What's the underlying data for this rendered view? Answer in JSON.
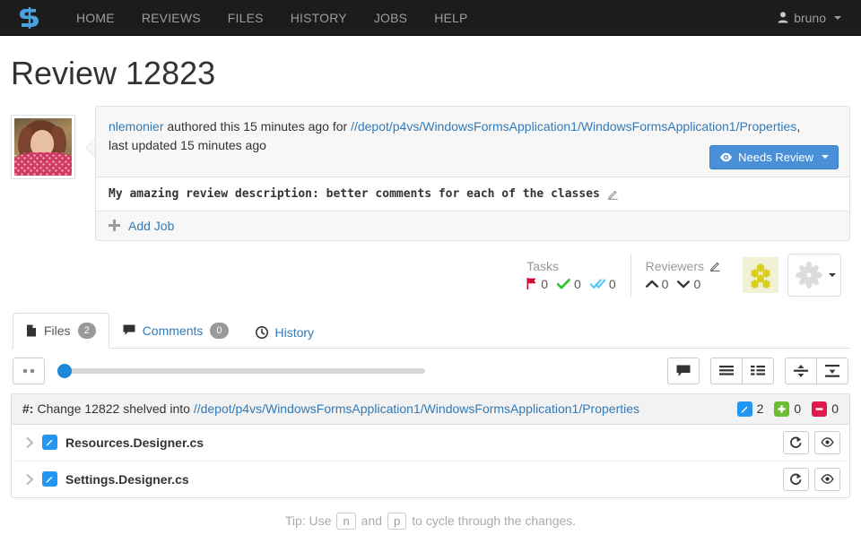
{
  "navbar": {
    "brand_icon": "swarm-s-logo-icon",
    "links": [
      {
        "label": "HOME",
        "name": "nav-link-home"
      },
      {
        "label": "REVIEWS",
        "name": "nav-link-reviews"
      },
      {
        "label": "FILES",
        "name": "nav-link-files"
      },
      {
        "label": "HISTORY",
        "name": "nav-link-history"
      },
      {
        "label": "JOBS",
        "name": "nav-link-jobs"
      },
      {
        "label": "HELP",
        "name": "nav-link-help"
      }
    ],
    "user": "bruno",
    "user_icon": "user-icon",
    "brand_color": "#4aa3df",
    "background": "#1c1c1c"
  },
  "page": {
    "title": "Review 12823"
  },
  "review": {
    "author": "nlemonier",
    "authored_text": "authored this 15 minutes ago for",
    "path": "//depot/p4vs/WindowsFormsApplication1/WindowsFormsApplication1/Properties",
    "path_suffix": ",",
    "updated_text": "last updated 15 minutes ago",
    "state_button": {
      "label": "Needs Review",
      "icon": "eye-icon",
      "color": "#4a90d9"
    },
    "description": "My amazing review description: better comments for each of the classes",
    "edit_icon": "pencil-icon",
    "add_job_label": "Add Job",
    "add_job_icon": "plus-icon"
  },
  "meta": {
    "tasks": {
      "label": "Tasks",
      "open": "0",
      "open_icon": "flag-icon",
      "addressed": "0",
      "addressed_icon": "check-icon",
      "verified": "0",
      "verified_icon": "double-check-icon"
    },
    "reviewers": {
      "label": "Reviewers",
      "edit_icon": "pencil-icon",
      "up": "0",
      "up_icon": "chevron-up-icon",
      "down": "0",
      "down_icon": "chevron-down-icon"
    },
    "avatars": {
      "hex_avatar": "hexagon-cluster-avatar",
      "flower_avatar": "flower-avatar",
      "dropdown_icon": "caret-down-icon"
    }
  },
  "tabs": [
    {
      "label": "Files",
      "badge": "2",
      "icon": "file-icon",
      "active": true,
      "name": "tab-files"
    },
    {
      "label": "Comments",
      "badge": "0",
      "icon": "comment-icon",
      "active": false,
      "name": "tab-comments"
    },
    {
      "label": "History",
      "badge": "",
      "icon": "clock-icon",
      "active": false,
      "name": "tab-history"
    }
  ],
  "toolbar": {
    "diff_toggle_icon": "ellipsis-icon",
    "slider_value": 0,
    "comment_icon": "comment-icon",
    "view_list_icon": "list-view-icon",
    "view_detail_icon": "detail-view-icon",
    "collapse_icon": "collapse-icon",
    "expand_icon": "expand-icon"
  },
  "change": {
    "lead": "#:",
    "text": "Change 12822 shelved into",
    "path": "//depot/p4vs/WindowsFormsApplication1/WindowsFormsApplication1/Properties",
    "stats": [
      {
        "icon": "edit-badge-icon",
        "color": "#2196f3",
        "glyph": "✎",
        "count": "2",
        "name": "stat-edited"
      },
      {
        "icon": "add-badge-icon",
        "color": "#6bbf2f",
        "glyph": "+",
        "count": "0",
        "name": "stat-added"
      },
      {
        "icon": "delete-badge-icon",
        "color": "#e01b4c",
        "glyph": "−",
        "count": "0",
        "name": "stat-deleted"
      }
    ]
  },
  "files": [
    {
      "name": "Resources.Designer.cs",
      "status_icon": "edit-badge-icon",
      "expand_icon": "chevron-right-icon",
      "open_icon": "open-external-icon",
      "view_icon": "eye-icon"
    },
    {
      "name": "Settings.Designer.cs",
      "status_icon": "edit-badge-icon",
      "expand_icon": "chevron-right-icon",
      "open_icon": "open-external-icon",
      "view_icon": "eye-icon"
    }
  ],
  "tip": {
    "prefix": "Tip: Use",
    "key1": "n",
    "middle": "and",
    "key2": "p",
    "suffix": "to cycle through the changes."
  }
}
